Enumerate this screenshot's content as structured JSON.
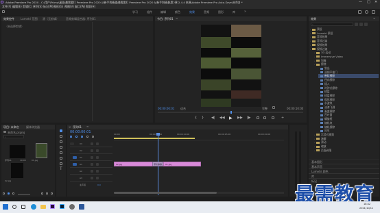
{
  "window": {
    "title": "Adobe Premiere Pro 2020 - C:\\用户\\Pr\\my\\桌面\\最需要打 Premiere Pro 2020 从新手到精通\\最需要打 Premiere Pro 2020 从新手到精通\\第2章\\2.4.4 来源\\Adobe Premiere Pro Auto-Save\\未命名 *",
    "menu": [
      "文件(F)",
      "编辑(E)",
      "剪辑(C)",
      "序列(S)",
      "标记(M)",
      "图形(G)",
      "视图(V)",
      "窗口(W)",
      "帮助(H)"
    ],
    "controls": [
      "—",
      "□",
      "✕"
    ]
  },
  "workspace_tabs": [
    "学习",
    "组件",
    "编辑",
    "颜色",
    "效果",
    "音频",
    "图形",
    "库"
  ],
  "workspace_active": "效果",
  "effect_controls": {
    "tabs": [
      "效果控件",
      "Lumetri 范围",
      "源（无剪辑）",
      "音频剪辑混合器: 序列01"
    ],
    "empty_text": "（未选择剪辑）"
  },
  "program_monitor": {
    "title": "节目: 序列01",
    "timecode": "00:00:00:01",
    "fit": "适合",
    "quality": "完整",
    "duration": "00:00:10:00",
    "controls": [
      "▶",
      "◀◀",
      "▶▶",
      "◀|",
      "|▶"
    ]
  },
  "effects_panel": {
    "title": "效果",
    "items": [
      {
        "label": "预设",
        "level": 0,
        "type": "folder"
      },
      {
        "label": "Lumetri 预设",
        "level": 0,
        "type": "folder"
      },
      {
        "label": "音频效果",
        "level": 0,
        "type": "folder"
      },
      {
        "label": "音频过渡",
        "level": 0,
        "type": "folder"
      },
      {
        "label": "视频效果",
        "level": 0,
        "type": "folder"
      },
      {
        "label": "视频过渡",
        "level": 0,
        "type": "folder"
      },
      {
        "label": "3D 运动",
        "level": 1,
        "type": "folder"
      },
      {
        "label": "Immersive Video",
        "level": 1,
        "type": "folder"
      },
      {
        "label": "划像",
        "level": 1,
        "type": "folder"
      },
      {
        "label": "擦除",
        "level": 1,
        "type": "folder"
      },
      {
        "label": "划出",
        "level": 2,
        "type": "effect"
      },
      {
        "label": "双侧平推门",
        "level": 2,
        "type": "effect"
      },
      {
        "label": "带状擦除",
        "level": 2,
        "type": "effect",
        "selected": true
      },
      {
        "label": "径向擦除",
        "level": 2,
        "type": "effect"
      },
      {
        "label": "插入",
        "level": 2,
        "type": "effect"
      },
      {
        "label": "时钟式擦除",
        "level": 2,
        "type": "effect"
      },
      {
        "label": "棋盘",
        "level": 2,
        "type": "effect"
      },
      {
        "label": "棋盘擦除",
        "level": 2,
        "type": "effect"
      },
      {
        "label": "楔形擦除",
        "level": 2,
        "type": "effect"
      },
      {
        "label": "水波块",
        "level": 2,
        "type": "effect"
      },
      {
        "label": "油漆飞溅",
        "level": 2,
        "type": "effect"
      },
      {
        "label": "渐变擦除",
        "level": 2,
        "type": "effect"
      },
      {
        "label": "百叶窗",
        "level": 2,
        "type": "effect"
      },
      {
        "label": "螺旋框",
        "level": 2,
        "type": "effect"
      },
      {
        "label": "随机块",
        "level": 2,
        "type": "effect"
      },
      {
        "label": "随机擦除",
        "level": 2,
        "type": "effect"
      },
      {
        "label": "风车",
        "level": 2,
        "type": "effect"
      },
      {
        "label": "沉浸式视频",
        "level": 1,
        "type": "folder"
      },
      {
        "label": "溶解",
        "level": 1,
        "type": "folder"
      },
      {
        "label": "滑动",
        "level": 1,
        "type": "folder"
      },
      {
        "label": "缩放",
        "level": 1,
        "type": "folder"
      },
      {
        "label": "页面剥落",
        "level": 1,
        "type": "folder"
      }
    ],
    "bottom_tabs": [
      "基本图形",
      "基本声音",
      "Lumetri 颜色",
      "库",
      "标记"
    ]
  },
  "project_panel": {
    "tabs": [
      "项目: 未命名",
      "媒体浏览器"
    ],
    "file": "未命名.prproj",
    "items": [
      {
        "label": "序列01",
        "meta": "10:00"
      },
      {
        "label": "01.jpg",
        "meta": ""
      },
      {
        "label": "02.jpg",
        "meta": ""
      },
      {
        "label": "",
        "meta": ""
      }
    ]
  },
  "timeline": {
    "tab": "序列01",
    "timecode": "00:00:00:01",
    "ruler": [
      "00:00",
      "00:00:05:00",
      "00:00:10:00",
      "00:00:15:00",
      "00:00:20:00",
      "00:00:25:00"
    ],
    "tracks": [
      {
        "name": "V3",
        "type": "video"
      },
      {
        "name": "V2",
        "type": "video"
      },
      {
        "name": "V1",
        "type": "video"
      },
      {
        "name": "A1",
        "type": "audio"
      },
      {
        "name": "A2",
        "type": "audio"
      },
      {
        "name": "A3",
        "type": "audio"
      }
    ],
    "master_label": "主声道",
    "master_value": "0.0",
    "clips": [
      {
        "label": "02.jpg",
        "track": "V1"
      },
      {
        "label": "带状擦除",
        "track": "V1"
      },
      {
        "label": "01.jpg",
        "track": "V1"
      }
    ]
  },
  "taskbar": {
    "time": "18:42",
    "date": "2021/10/11",
    "apps": [
      "windows",
      "search",
      "task-view",
      "edge",
      "explorer",
      "store",
      "premiere",
      "ps",
      "settings",
      "word"
    ]
  },
  "watermark": "最需教育",
  "colors": {
    "accent_blue": "#4f8ee8",
    "clip_pink": "#d98ad9",
    "playhead": "#5b8de0",
    "panel": "#232323",
    "bg": "#1d1d1d"
  }
}
